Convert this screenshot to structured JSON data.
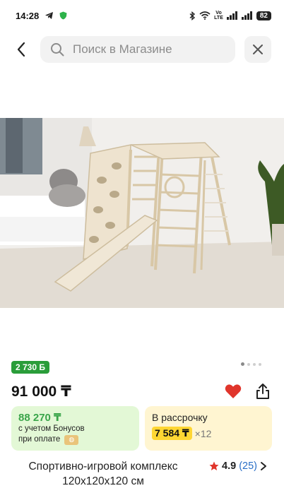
{
  "status_bar": {
    "time": "14:28",
    "network_label_top": "Vo",
    "network_label_bottom": "LTE",
    "battery": "82"
  },
  "search": {
    "placeholder": "Поиск в Магазине"
  },
  "gallery": {
    "dots_count": 4,
    "active_index": 0
  },
  "product": {
    "bonus_badge": "2 730 Б",
    "price": "91 000 ₸",
    "bonus_price": "88 270 ₸",
    "bonus_note_line1": "с учетом Бонусов",
    "bonus_note_line2": "при оплате",
    "installment_label": "В рассрочку",
    "installment_price": "7 584 ₸",
    "installment_multiplier": "×12",
    "title": "Спортивно-игровой комплекс 120х120х120 см",
    "rating": "4.9",
    "reviews": "(25)"
  },
  "colors": {
    "accent_green": "#2a9d3a",
    "favorite_red": "#e0352b",
    "rating_star": "#e0352b",
    "installment_yellow": "#ffd633"
  },
  "icons": {
    "back": "chevron-left-icon",
    "search": "search-icon",
    "close": "close-icon",
    "favorite": "heart-icon",
    "share": "share-icon",
    "star": "star-icon",
    "chevron": "chevron-right-icon"
  }
}
